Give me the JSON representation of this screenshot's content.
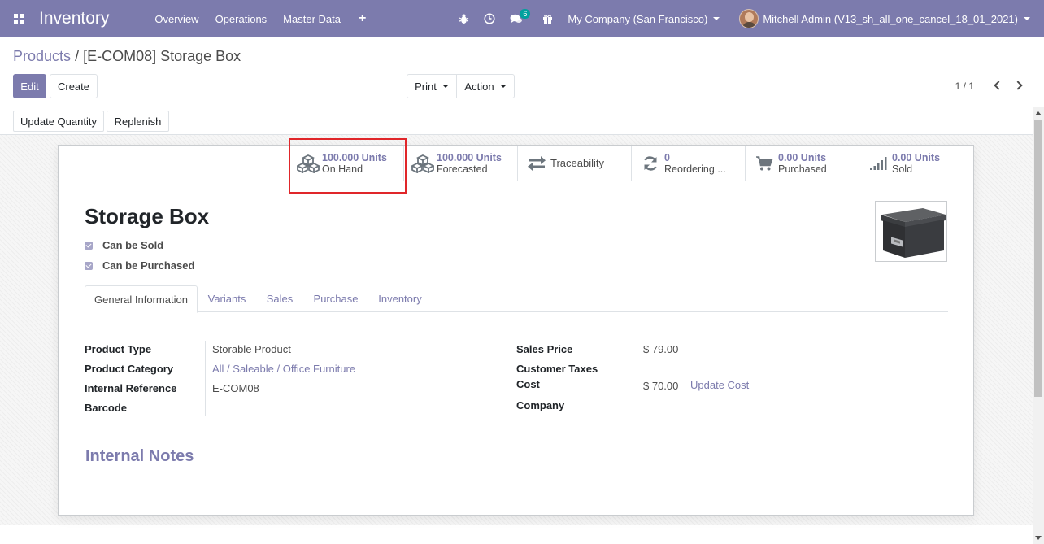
{
  "navbar": {
    "app_name": "Inventory",
    "menu": [
      "Overview",
      "Operations",
      "Master Data"
    ],
    "plus_icon": "+",
    "chat_badge": "6",
    "company": "My Company (San Francisco)",
    "user": "Mitchell Admin (V13_sh_all_one_cancel_18_01_2021)",
    "color": "#7c7bad"
  },
  "breadcrumb": {
    "parent": "Products",
    "separator": "/",
    "current": "[E-COM08] Storage Box"
  },
  "control_panel": {
    "edit_label": "Edit",
    "create_label": "Create",
    "print_label": "Print",
    "action_label": "Action",
    "pager": "1 / 1"
  },
  "statusbar": {
    "update_quantity": "Update Quantity",
    "replenish": "Replenish"
  },
  "smart_buttons": [
    {
      "icon": "cubes-icon",
      "value": "100.000 Units",
      "label": "On Hand"
    },
    {
      "icon": "cubes-icon",
      "value": "100.000 Units",
      "label": "Forecasted"
    },
    {
      "icon": "exchange-arrows-icon",
      "label": "Traceability"
    },
    {
      "icon": "refresh-icon",
      "value": "0",
      "label": "Reordering ..."
    },
    {
      "icon": "shopping-cart-icon",
      "value": "0.00 Units",
      "label": "Purchased"
    },
    {
      "icon": "signal-bars-icon",
      "value": "0.00 Units",
      "label": "Sold"
    }
  ],
  "product": {
    "name": "Storage Box",
    "can_be_sold": "Can be Sold",
    "can_be_purchased": "Can be Purchased"
  },
  "tabs": [
    "General Information",
    "Variants",
    "Sales",
    "Purchase",
    "Inventory"
  ],
  "general": {
    "left": [
      {
        "label": "Product Type",
        "value": "Storable Product"
      },
      {
        "label": "Product Category",
        "value": "All / Saleable / Office Furniture"
      },
      {
        "label": "Internal Reference",
        "value": "E-COM08"
      },
      {
        "label": "Barcode",
        "value": ""
      }
    ],
    "right": [
      {
        "label": "Sales Price",
        "value": "$ 79.00"
      },
      {
        "label": "Customer Taxes",
        "value": ""
      },
      {
        "label": "Cost",
        "value": "$ 70.00"
      },
      {
        "label": "Company",
        "value": ""
      }
    ],
    "update_cost": "Update Cost"
  },
  "notes_title": "Internal Notes"
}
